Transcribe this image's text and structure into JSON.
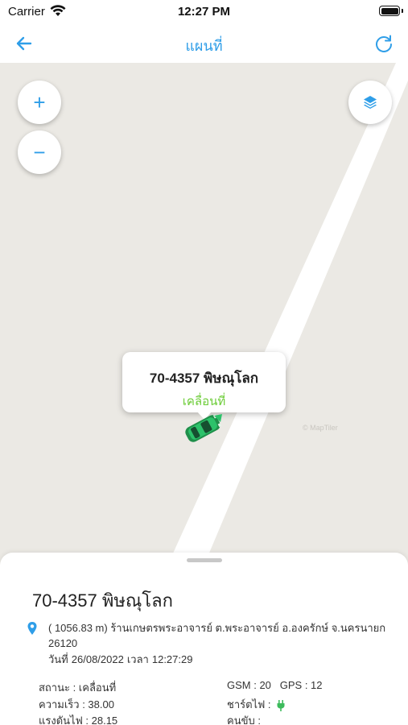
{
  "status_bar": {
    "carrier": "Carrier",
    "time": "12:27 PM"
  },
  "nav": {
    "title": "แผนที่",
    "back_icon": "arrow-left-icon",
    "refresh_icon": "refresh-icon",
    "accent_color": "#2f9ee8"
  },
  "map": {
    "zoom_in_label": "+",
    "zoom_out_label": "−",
    "layers_icon": "layers-icon",
    "watermark": "© MapTiler",
    "callout": {
      "title": "70-4357 พิษณุโลก",
      "status": "เคลื่อนที่",
      "status_color": "#6ccc37"
    },
    "vehicle_icon": "car-icon",
    "background_color": "#ebe9e4",
    "road_color": "#ffffff"
  },
  "detail": {
    "title": "70-4357 พิษณุโลก",
    "address": "( 1056.83 m) ร้านเกษตรพระอาจารย์ ต.พระอาจารย์ อ.องครักษ์ จ.นครนายก 26120",
    "date_prefix": "วันที่",
    "date": "26/08/2022",
    "time_prefix": "เวลา",
    "time": "12:27:29",
    "status_label": "สถานะ : เคลื่อนที่",
    "speed_label": "ความเร็ว : 38.00",
    "voltage_label": "แรงดันไฟ : 28.15",
    "gsm_label": "GSM : 20",
    "gps_label": "GPS : 12",
    "charging_label": "ชาร์ตไฟ :",
    "charging_icon": "plug-icon",
    "driver_label": "คนขับ :"
  }
}
